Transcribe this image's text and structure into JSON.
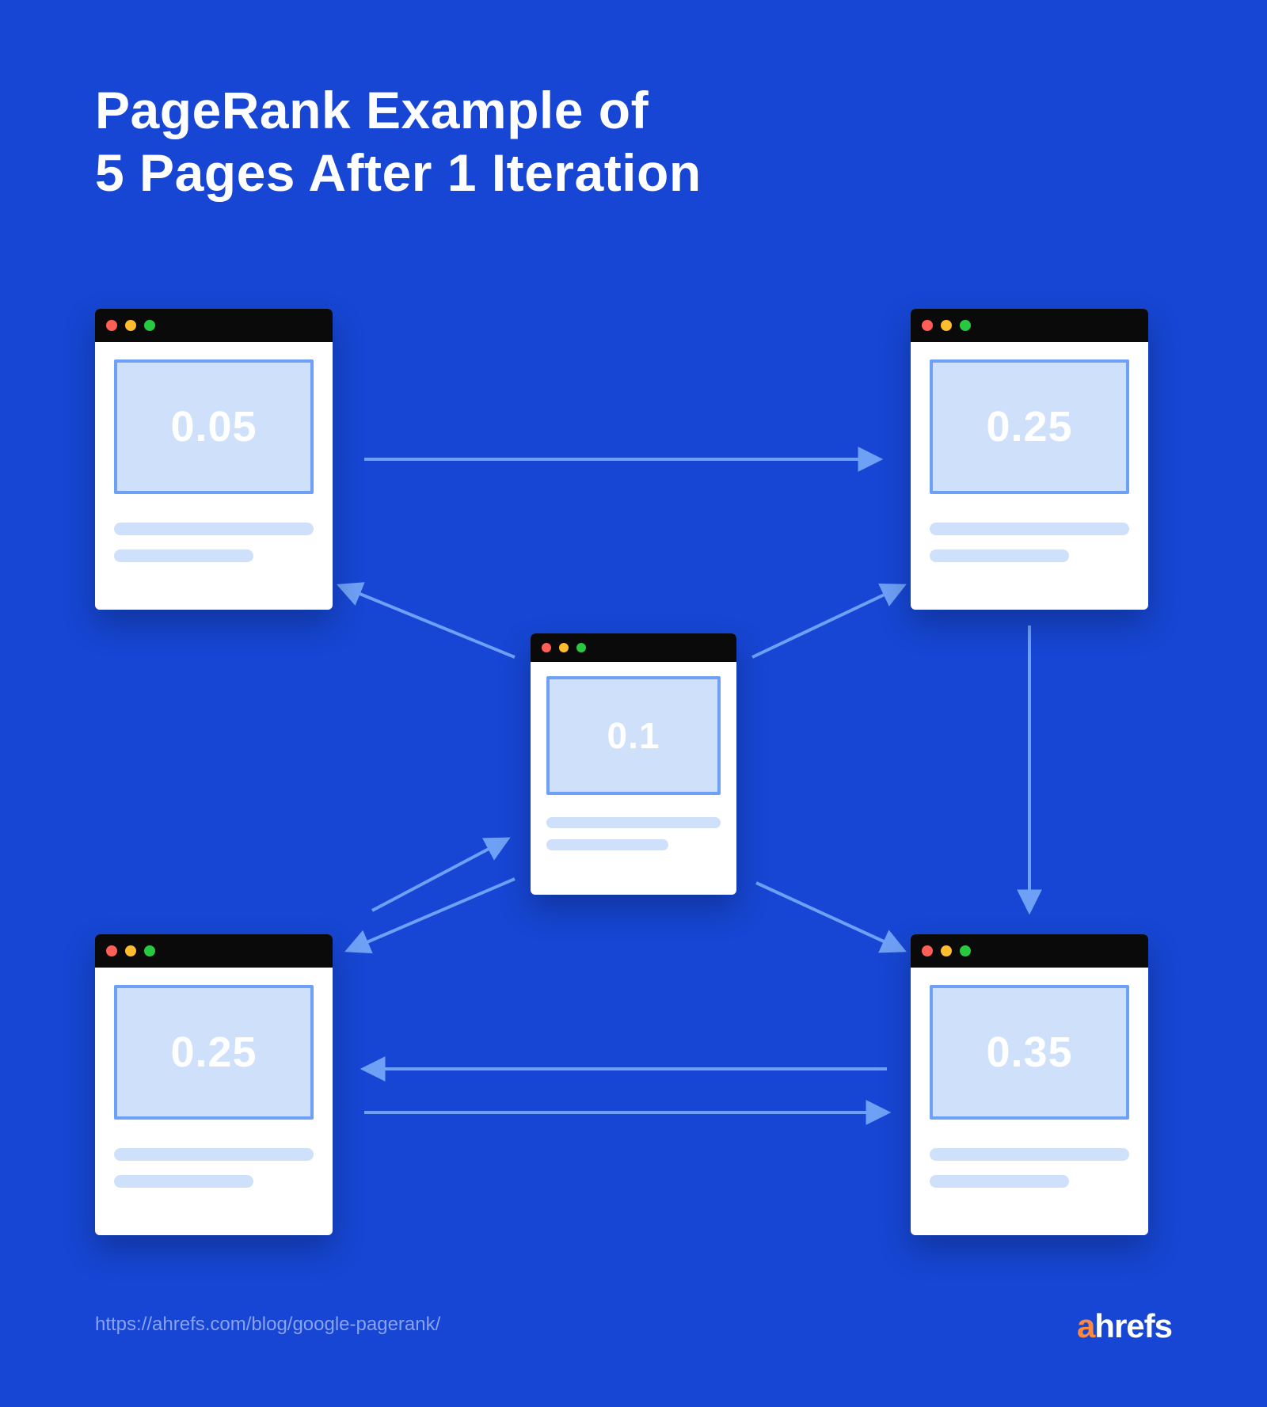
{
  "title_line1": "PageRank Example of",
  "title_line2": "5 Pages After 1 Iteration",
  "pages": {
    "top_left": {
      "value": "0.05"
    },
    "top_right": {
      "value": "0.25"
    },
    "center": {
      "value": "0.1"
    },
    "bottom_left": {
      "value": "0.25"
    },
    "bottom_right": {
      "value": "0.35"
    }
  },
  "source_url": "https://ahrefs.com/blog/google-pagerank/",
  "brand": {
    "name": "ahrefs",
    "accent_char": "a",
    "rest": "hrefs"
  },
  "chart_data": {
    "type": "diagram",
    "title": "PageRank Example of 5 Pages After 1 Iteration",
    "nodes": [
      {
        "id": "A",
        "position": "top_left",
        "pagerank": 0.05
      },
      {
        "id": "B",
        "position": "top_right",
        "pagerank": 0.25
      },
      {
        "id": "C",
        "position": "center",
        "pagerank": 0.1
      },
      {
        "id": "D",
        "position": "bottom_left",
        "pagerank": 0.25
      },
      {
        "id": "E",
        "position": "bottom_right",
        "pagerank": 0.35
      }
    ],
    "edges": [
      {
        "from": "A",
        "to": "B"
      },
      {
        "from": "C",
        "to": "A"
      },
      {
        "from": "C",
        "to": "B"
      },
      {
        "from": "C",
        "to": "D"
      },
      {
        "from": "C",
        "to": "E"
      },
      {
        "from": "D",
        "to": "C"
      },
      {
        "from": "B",
        "to": "E"
      },
      {
        "from": "E",
        "to": "D"
      },
      {
        "from": "D",
        "to": "E"
      }
    ]
  }
}
